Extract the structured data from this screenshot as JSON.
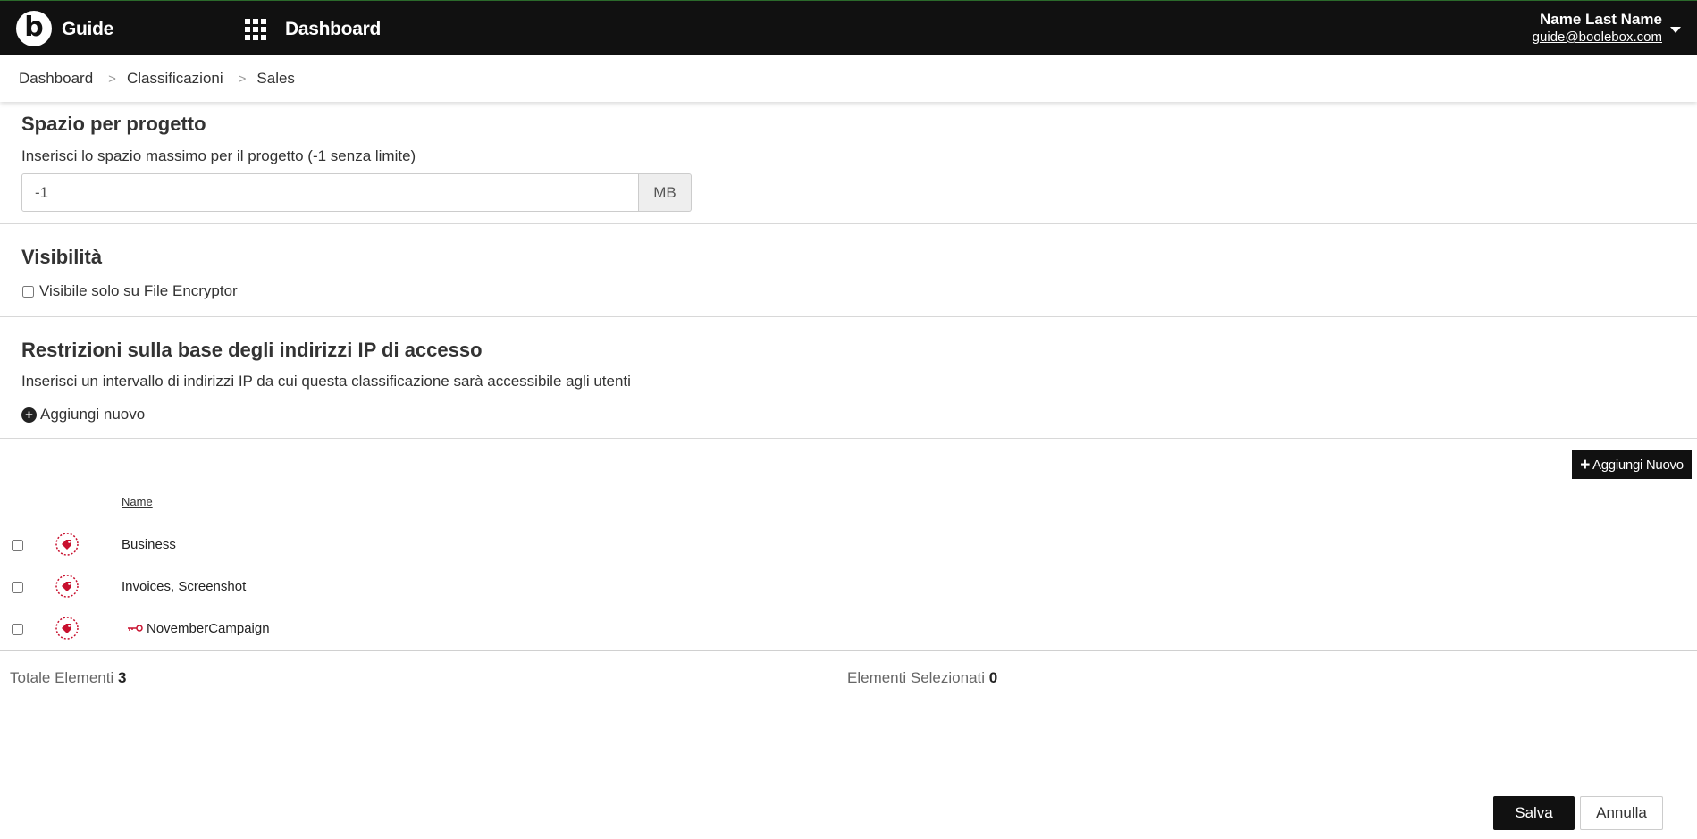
{
  "topbar": {
    "app_name": "Guide",
    "nav_title": "Dashboard",
    "user_name": "Name Last Name",
    "user_email": "guide@boolebox.com",
    "logo_letter": "b"
  },
  "breadcrumb": {
    "items": [
      "Dashboard",
      "Classificazioni",
      "Sales"
    ],
    "separator": ">"
  },
  "space_section": {
    "title": "Spazio per progetto",
    "description": "Inserisci lo spazio massimo per il progetto (-1 senza limite)",
    "value": "-1",
    "unit": "MB"
  },
  "visibility_section": {
    "title": "Visibilità",
    "checkbox_label": "Visibile solo su File Encryptor",
    "checked": false
  },
  "ip_section": {
    "title": "Restrizioni sulla base degli indirizzi IP di accesso",
    "description": "Inserisci un intervallo di indirizzi IP da cui questa classificazione sarà accessibile agli utenti",
    "add_link": "Aggiungi nuovo"
  },
  "table": {
    "add_button": "Aggiungi Nuovo",
    "column_name": "Name",
    "rows": [
      {
        "name": "Business",
        "icon": "tag-icon",
        "has_key": false
      },
      {
        "name": "Invoices, Screenshot",
        "icon": "tag-icon",
        "has_key": false
      },
      {
        "name": "NovemberCampaign",
        "icon": "tag-icon",
        "has_key": true
      }
    ],
    "total_label": "Totale Elementi",
    "total_value": "3",
    "selected_label": "Elementi Selezionati",
    "selected_value": "0"
  },
  "footer": {
    "save": "Salva",
    "cancel": "Annulla"
  },
  "colors": {
    "topbar": "#111111",
    "tag_red": "#c8102e",
    "button_dark": "#111111"
  }
}
